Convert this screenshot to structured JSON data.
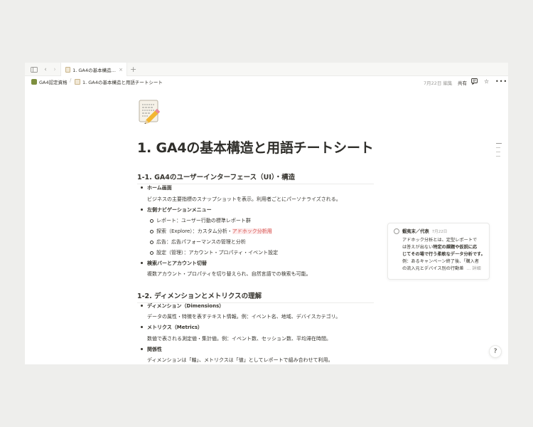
{
  "tab": {
    "title": "1. GA4の基本構造と用..."
  },
  "breadcrumb": {
    "parent": "GA4認定資格",
    "current": "1. GA4の基本構造と用語チートシート"
  },
  "topbar": {
    "edited": "7月22日 編集",
    "share": "共有"
  },
  "page": {
    "title": "1. GA4の基本構造と用語チートシート",
    "sections": [
      {
        "heading": "1-1. GA4のユーザーインターフェース（UI）・構造",
        "items": [
          {
            "title": "ホーム画面",
            "text": "ビジネスの主要指標のスナップショットを表示。利用者ごとにパーソナライズされる。"
          },
          {
            "title": "左側ナビゲーションメニュー",
            "sub": [
              "レポート：ユーザー行動の標準レポート群",
              "探索（Explore）：カスタム分析・",
              "広告：広告パフォーマンスの管理と分析",
              "設定（管理）：アカウント・プロパティ・イベント設定"
            ],
            "highlight": "アドホック分析用"
          },
          {
            "title": "検索バーとアカウント切替",
            "text": "複数アカウント・プロパティを切り替えられ、自然言語での検索も可能。"
          }
        ]
      },
      {
        "heading": "1-2. ディメンションとメトリクスの理解",
        "items": [
          {
            "title": "ディメンション（Dimensions）",
            "text": "データの属性・特徴を表すテキスト情報。例：イベント名、地域、デバイスカテゴリ。"
          },
          {
            "title": "メトリクス（Metrics）",
            "text": "数値で表される測定値・集計値。例：イベント数、セッション数、平均滞在時間。"
          },
          {
            "title": "関係性",
            "text": "ディメンションは「軸」、メトリクスは「値」としてレポートで組み合わせて利用。"
          }
        ]
      }
    ]
  },
  "comment": {
    "author": "蝦夷末／代表",
    "date": "7月22日",
    "line1": "アドホック分析とは、定型レポートで",
    "line2a": "は答えが出ない",
    "line2b": "特定の課題や仮説に応",
    "line3": "じてその場で行う柔軟なデータ分析です。",
    "line4": "例：あるキャンペーン終了後、「購入者",
    "line5": "の流入元とデバイス別の行動差",
    "more": "... 詳細"
  },
  "icons": {
    "sidebar_toggle": "sidebar-toggle-icon",
    "back": "chevron-left-icon",
    "forward": "chevron-right-icon",
    "new_tab": "plus-icon",
    "comment": "comment-icon",
    "star": "star-icon",
    "more": "more-icon",
    "help": "help-icon"
  },
  "colors": {
    "highlight_text": "#d44c47",
    "highlight_bg": "#fdebec"
  }
}
